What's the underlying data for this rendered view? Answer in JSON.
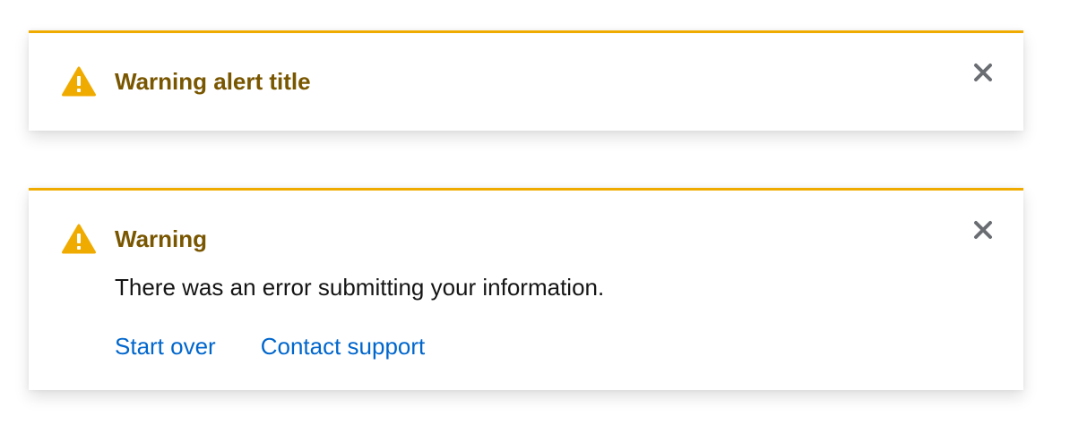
{
  "colors": {
    "warning_accent": "#f0ab00",
    "title_text": "#795600",
    "body_text": "#151515",
    "link": "#0066cc",
    "close_icon": "#6a6e73"
  },
  "alerts": [
    {
      "icon": "warning-triangle-icon",
      "title": "Warning alert title",
      "close_icon": "close-icon"
    },
    {
      "icon": "warning-triangle-icon",
      "title": "Warning",
      "description": "There was an error submitting your information.",
      "close_icon": "close-icon",
      "actions": [
        {
          "label": "Start over"
        },
        {
          "label": "Contact support"
        }
      ]
    }
  ]
}
